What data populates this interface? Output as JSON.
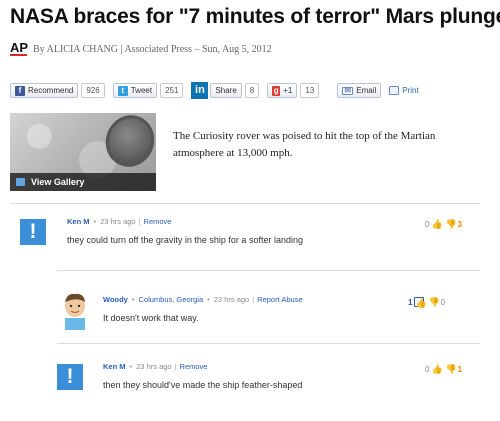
{
  "article": {
    "headline": "NASA braces for \"7 minutes of terror\" Mars plunge",
    "ap_logo": "AP",
    "byline": "By ALICIA CHANG | Associated Press – Sun, Aug 5, 2012",
    "summary": "The Curiosity rover was poised to hit the top of the Martian atmosphere at 13,000 mph."
  },
  "share": {
    "recommend_label": "Recommend",
    "recommend_count": "926",
    "tweet_label": "Tweet",
    "tweet_count": "251",
    "linkedin_label": "Share",
    "linkedin_count": "8",
    "gplus_label": "+1",
    "gplus_count": "13",
    "email_label": "Email",
    "print_label": "Print"
  },
  "gallery": {
    "label": "View Gallery"
  },
  "comments": [
    {
      "name": "Ken M",
      "time": "23 hrs ago",
      "action": "Remove",
      "text": "they could turn off the gravity in the ship for a softer landing",
      "up": "0",
      "down": "3"
    },
    {
      "name": "Woody",
      "location": "Columbus, Georgia",
      "time": "23 hrs ago",
      "action": "Report Abuse",
      "text": "It doesn't work that way.",
      "up": "1",
      "down": "0"
    },
    {
      "name": "Ken M",
      "time": "23 hrs ago",
      "action": "Remove",
      "text": "then they should've made the ship feather-shaped",
      "up": "0",
      "down": "1"
    }
  ],
  "colors": {
    "link": "#2a5db0",
    "avatar_placeholder": "#3a8fd8",
    "downvote": "#e08a00",
    "ap_red": "#dd2222"
  },
  "icons": {
    "facebook": "facebook-icon",
    "twitter": "twitter-bird-icon",
    "linkedin": "linkedin-icon",
    "gplus": "google-plus-icon",
    "email": "envelope-icon",
    "print": "printer-icon",
    "gallery": "gallery-icon",
    "thumbs_up": "thumbs-up-icon",
    "thumbs_down": "thumbs-down-icon"
  }
}
